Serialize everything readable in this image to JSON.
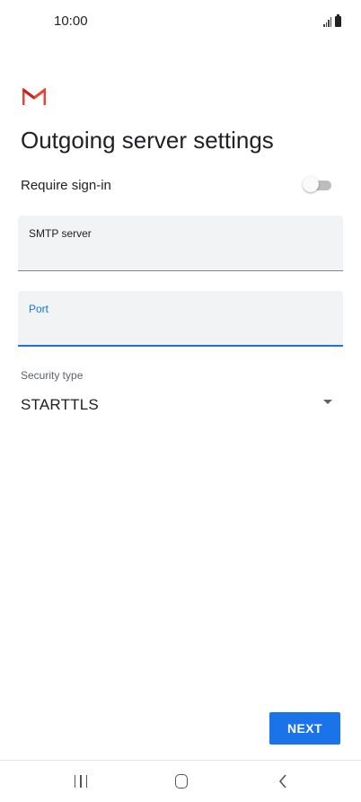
{
  "status_bar": {
    "time": "10:00",
    "signal_icon": "signal-icon",
    "battery_icon": "battery-icon"
  },
  "logo": {
    "icon": "gmail-icon",
    "colors": [
      "#ea4335",
      "#c5221f"
    ]
  },
  "page": {
    "title": "Outgoing server settings"
  },
  "require_signin": {
    "label": "Require sign-in",
    "enabled": false
  },
  "smtp_field": {
    "label": "SMTP server",
    "value": ""
  },
  "port_field": {
    "label": "Port",
    "value": "",
    "focused": true
  },
  "security": {
    "label": "Security type",
    "value": "STARTTLS"
  },
  "actions": {
    "next_label": "NEXT"
  },
  "nav_bar": {
    "recent_icon": "recent-apps-icon",
    "home_icon": "home-icon",
    "back_icon": "back-icon"
  },
  "colors": {
    "accent": "#1a73e8",
    "field_background": "#f1f3f4",
    "text": "#202124"
  }
}
